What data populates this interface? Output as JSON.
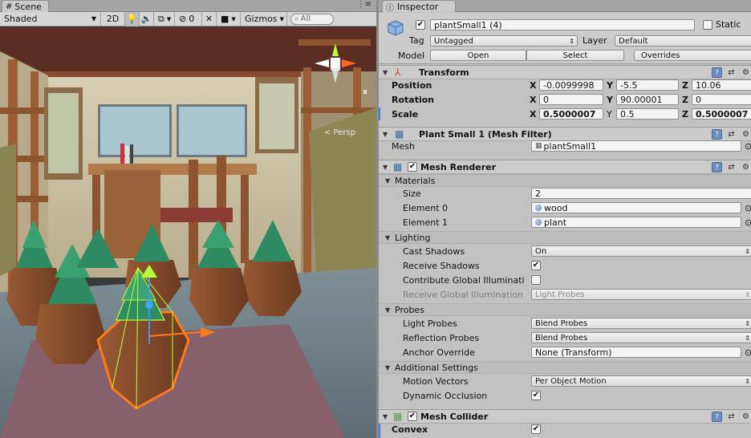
{
  "scene": {
    "tab_label": "Scene",
    "toolbar": {
      "shading": "Shaded",
      "mode_2d": "2D",
      "hidden_count": "0",
      "gizmos": "Gizmos",
      "search_placeholder": "All"
    },
    "persp_label": "< Persp",
    "gizmo_axes": {
      "x": "x",
      "y": "y"
    }
  },
  "inspector": {
    "tab_label": "Inspector",
    "object": {
      "name": "plantSmall1 (4)",
      "active": true,
      "static_label": "Static",
      "tag_label": "Tag",
      "tag_value": "Untagged",
      "layer_label": "Layer",
      "layer_value": "Default",
      "model_label": "Model",
      "open_button": "Open",
      "select_button": "Select",
      "overrides_button": "Overrides"
    },
    "transform": {
      "title": "Transform",
      "position_label": "Position",
      "rotation_label": "Rotation",
      "scale_label": "Scale",
      "position": {
        "x": "-0.0099998",
        "y": "-5.5",
        "z": "10.06"
      },
      "rotation": {
        "x": "0",
        "y": "90.00001",
        "z": "0"
      },
      "scale": {
        "x": "0.5000007",
        "y": "0.5",
        "z": "0.5000007"
      }
    },
    "mesh_filter": {
      "title": "Plant Small 1 (Mesh Filter)",
      "mesh_label": "Mesh",
      "mesh_value": "plantSmall1"
    },
    "mesh_renderer": {
      "title": "Mesh Renderer",
      "enabled": true,
      "materials_label": "Materials",
      "size_label": "Size",
      "size_value": "2",
      "element0_label": "Element 0",
      "element0_value": "wood",
      "element1_label": "Element 1",
      "element1_value": "plant",
      "lighting_label": "Lighting",
      "cast_shadows_label": "Cast Shadows",
      "cast_shadows_value": "On",
      "receive_shadows_label": "Receive Shadows",
      "receive_shadows": true,
      "contribute_gi_label": "Contribute Global Illuminati",
      "contribute_gi": false,
      "receive_gi_label": "Receive Global Illumination",
      "receive_gi_value": "Light Probes",
      "probes_label": "Probes",
      "light_probes_label": "Light Probes",
      "light_probes_value": "Blend Probes",
      "reflection_probes_label": "Reflection Probes",
      "reflection_probes_value": "Blend Probes",
      "anchor_override_label": "Anchor Override",
      "anchor_override_value": "None (Transform)",
      "additional_label": "Additional Settings",
      "motion_vectors_label": "Motion Vectors",
      "motion_vectors_value": "Per Object Motion",
      "dynamic_occlusion_label": "Dynamic Occlusion",
      "dynamic_occlusion": true
    },
    "mesh_collider": {
      "title": "Mesh Collider",
      "enabled": true,
      "convex_label": "Convex",
      "convex": true
    }
  },
  "colors": {
    "selection_outline": "#ff7a1a",
    "selection_wire": "#b6ff3a",
    "accent_blue": "#3e7de0"
  }
}
